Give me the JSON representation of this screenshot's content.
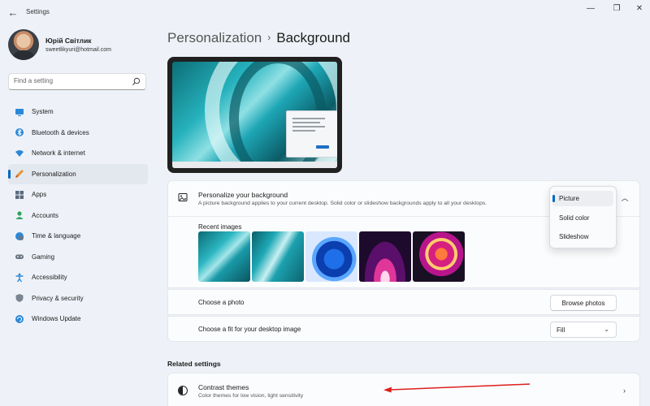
{
  "window": {
    "app_title": "Settings",
    "back_glyph": "←",
    "minimize_glyph": "—",
    "maximize_glyph": "❐",
    "close_glyph": "✕"
  },
  "profile": {
    "name": "Юрій Світлик",
    "email": "sweetlikyuri@hotmail.com"
  },
  "search": {
    "placeholder": "Find a setting"
  },
  "sidebar": {
    "items": [
      {
        "label": "System",
        "icon": "monitor-icon",
        "active": false
      },
      {
        "label": "Bluetooth & devices",
        "icon": "bluetooth-icon",
        "active": false
      },
      {
        "label": "Network & internet",
        "icon": "wifi-icon",
        "active": false
      },
      {
        "label": "Personalization",
        "icon": "brush-icon",
        "active": true
      },
      {
        "label": "Apps",
        "icon": "apps-icon",
        "active": false
      },
      {
        "label": "Accounts",
        "icon": "person-icon",
        "active": false
      },
      {
        "label": "Time & language",
        "icon": "globe-clock-icon",
        "active": false
      },
      {
        "label": "Gaming",
        "icon": "gamepad-icon",
        "active": false
      },
      {
        "label": "Accessibility",
        "icon": "accessibility-icon",
        "active": false
      },
      {
        "label": "Privacy & security",
        "icon": "shield-icon",
        "active": false
      },
      {
        "label": "Windows Update",
        "icon": "update-icon",
        "active": false
      }
    ]
  },
  "header": {
    "parent": "Personalization",
    "separator": "›",
    "current": "Background"
  },
  "personalize": {
    "title": "Personalize your background",
    "description": "A picture background applies to your current desktop. Solid color or slideshow backgrounds apply to all your desktops.",
    "recent_label": "Recent images",
    "collapse_glyph": "︿",
    "dropdown_options": [
      {
        "label": "Picture",
        "selected": true
      },
      {
        "label": "Solid color",
        "selected": false
      },
      {
        "label": "Slideshow",
        "selected": false
      }
    ]
  },
  "choose_photo": {
    "label": "Choose a photo",
    "button": "Browse photos"
  },
  "choose_fit": {
    "label": "Choose a fit for your desktop image",
    "value": "Fill",
    "chevron_glyph": "⌄"
  },
  "related": {
    "heading": "Related settings",
    "items": [
      {
        "title": "Contrast themes",
        "description": "Color themes for low vision, light sensitivity",
        "chevron": "›"
      }
    ]
  },
  "colors": {
    "accent": "#0067c0",
    "annotation_arrow": "#e01e1e",
    "background": "#eef2f8",
    "card": "#fbfcfd"
  }
}
